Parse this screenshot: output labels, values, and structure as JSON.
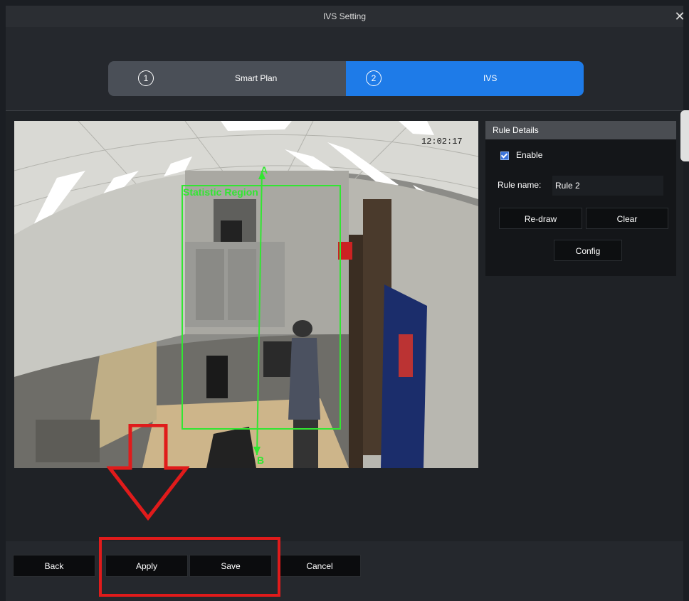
{
  "window": {
    "title": "IVS Setting",
    "close_label": "✕"
  },
  "stepper": {
    "steps": [
      {
        "number": "1",
        "label": "Smart Plan",
        "active": false
      },
      {
        "number": "2",
        "label": "IVS",
        "active": true
      }
    ]
  },
  "video": {
    "timestamp": "12:02:17",
    "overlay_region_label": "Statistic Region",
    "line_point_a": "A",
    "line_point_b": "B"
  },
  "rule_details": {
    "header": "Rule Details",
    "enable_label": "Enable",
    "enable_checked": true,
    "rule_name_label": "Rule name:",
    "rule_name_value": "Rule 2",
    "redraw_label": "Re-draw",
    "clear_label": "Clear",
    "config_label": "Config"
  },
  "footer": {
    "back_label": "Back",
    "apply_label": "Apply",
    "save_label": "Save",
    "cancel_label": "Cancel"
  },
  "colors": {
    "accent": "#1e7be8",
    "overlay_green": "#32e632",
    "annotation_red": "#e01b1b"
  }
}
